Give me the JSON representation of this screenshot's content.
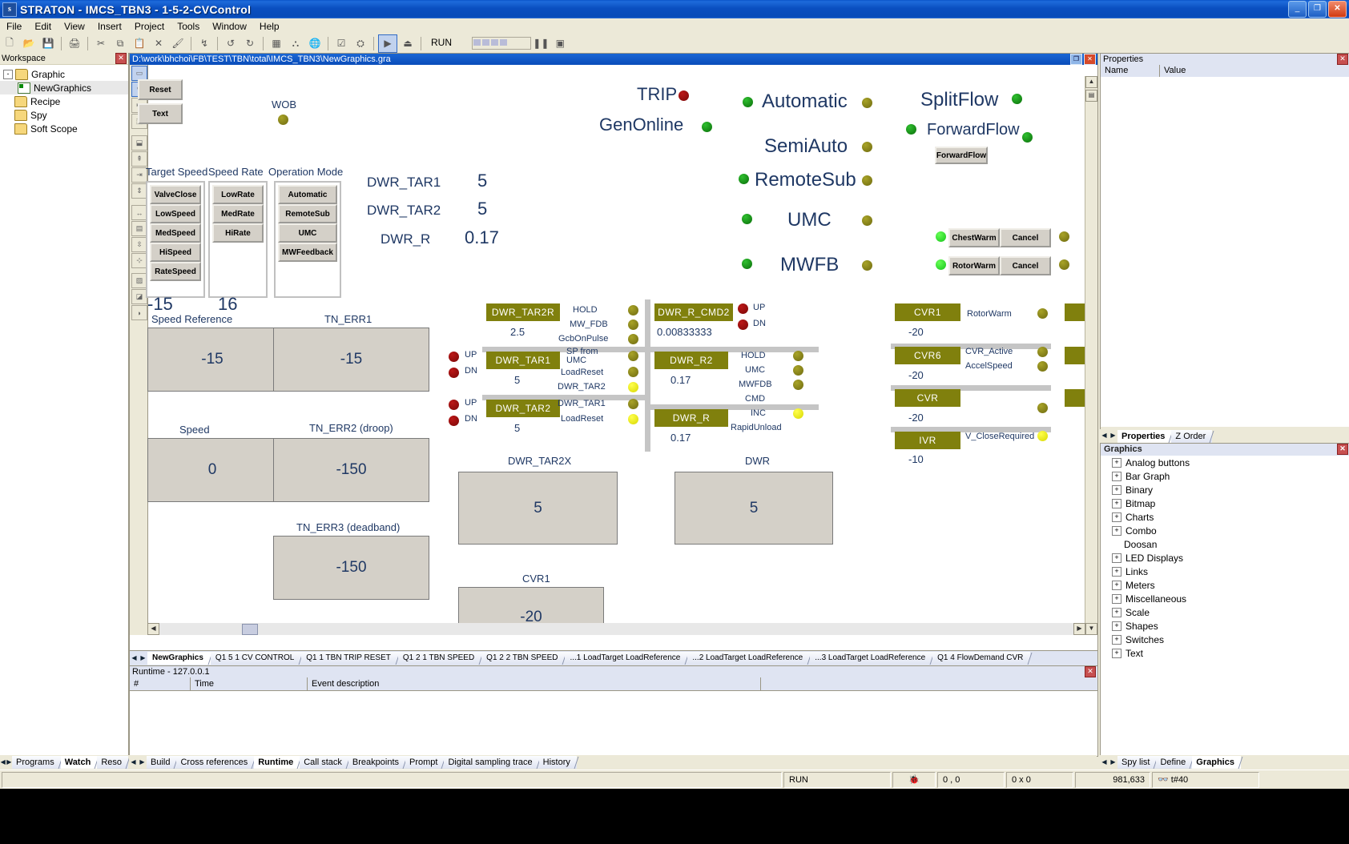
{
  "window": {
    "title": "STRATON - IMCS_TBN3 - 1-5-2-CVControl",
    "app_icon": "s",
    "minimize": "_",
    "maximize": "❐",
    "close": "✕"
  },
  "menu": [
    "File",
    "Edit",
    "View",
    "Insert",
    "Project",
    "Tools",
    "Window",
    "Help"
  ],
  "toolbar": {
    "icons": [
      "new-icon",
      "open-icon",
      "save-icon",
      "print-icon",
      "cut-icon",
      "copy-icon",
      "paste-icon",
      "delete-icon",
      "format-paint-icon",
      "undo-dropdown-icon",
      "undo-icon",
      "redo-icon",
      "grid-icon",
      "hierarchy-icon",
      "globe-icon",
      "check-icon",
      "compile-icon",
      "run-debug-icon",
      "stop-icon"
    ],
    "run_label": "RUN",
    "pause_icon": "❚❚",
    "stop_icon": "■"
  },
  "workspace": {
    "title": "Workspace",
    "close": "✕",
    "items": [
      {
        "label": "Graphic",
        "type": "folder",
        "toggle": "-",
        "selected": false
      },
      {
        "label": "NewGraphics",
        "type": "graphic",
        "toggle": "",
        "selected": true
      },
      {
        "label": "Recipe",
        "type": "folder",
        "toggle": "",
        "selected": false
      },
      {
        "label": "Spy",
        "type": "folder",
        "toggle": "",
        "selected": false
      },
      {
        "label": "Soft Scope",
        "type": "folder",
        "toggle": "",
        "selected": false
      }
    ],
    "tabs": [
      {
        "label": "Programs",
        "active": false
      },
      {
        "label": "Watch",
        "active": true
      },
      {
        "label": "Reso",
        "active": false
      }
    ]
  },
  "document": {
    "path": "D:\\work\\bhchoi\\FB\\TEST\\TBN\\total\\IMCS_TBN3\\NewGraphics.gra",
    "restore": "❐",
    "close": "✕"
  },
  "palette": {
    "buttons": [
      "select-rect-icon",
      "pointer-icon",
      "align-left-icon",
      "group-icon",
      "align-icons-icon",
      "align-top-icon",
      "align-right-icon",
      "center-vertical-icon",
      "distribute-h-icon",
      "distribute-v-icon",
      "spacing-icon",
      "pattern-icon",
      "pattern2-icon",
      "fill-icon"
    ]
  },
  "canvas": {
    "tool_buttons": [
      {
        "label": "Reset",
        "icon": "rect-tool-icon"
      },
      {
        "label": "Text",
        "icon": "text-tool-icon"
      }
    ],
    "wob": {
      "label": "WOB",
      "led": "olive"
    },
    "group_headers": [
      "Target Speed",
      "Speed Rate",
      "Operation Mode"
    ],
    "speed_buttons": [
      "ValveClose",
      "LowSpeed",
      "MedSpeed",
      "HiSpeed",
      "RateSpeed"
    ],
    "rate_buttons": [
      "LowRate",
      "MedRate",
      "HiRate"
    ],
    "mode_buttons": [
      "Automatic",
      "RemoteSub",
      "UMC",
      "MWFeedback"
    ],
    "group_values": [
      "-15",
      "16"
    ],
    "var_rows": [
      {
        "name": "DWR_TAR1",
        "value": "5"
      },
      {
        "name": "DWR_TAR2",
        "value": "5"
      },
      {
        "name": "DWR_R",
        "value": "0.17"
      }
    ],
    "status_left": [
      {
        "label": "TRIP",
        "led": "red",
        "side": "right"
      },
      {
        "label": "GenOnline",
        "led": "green",
        "side": "right"
      }
    ],
    "modes": [
      {
        "label": "Automatic",
        "led_left": "green",
        "led_right": "olive"
      },
      {
        "label": "SemiAuto",
        "led_left": "",
        "led_right": "olive"
      },
      {
        "label": "RemoteSub",
        "led_left": "green",
        "led_right": "olive"
      },
      {
        "label": "UMC",
        "led_left": "green",
        "led_right": "olive"
      },
      {
        "label": "MWFB",
        "led_left": "green",
        "led_right": "olive"
      }
    ],
    "flow": [
      {
        "label": "SplitFlow",
        "led": "green"
      },
      {
        "label": "ForwardFlow",
        "led": "green",
        "button": "ForwardFlow"
      }
    ],
    "warm_rows": [
      {
        "led": "bright-green",
        "button": "ChestWarm",
        "cancel": "Cancel",
        "led_right": "olive"
      },
      {
        "led": "bright-green",
        "button": "RotorWarm",
        "cancel": "Cancel",
        "led_right": "olive"
      }
    ],
    "meters": [
      {
        "title": "Speed Reference",
        "value": "-15"
      },
      {
        "title": "TN_ERR1",
        "value": "-15"
      },
      {
        "title": "Speed",
        "value": "0"
      },
      {
        "title": "TN_ERR2 (droop)",
        "value": "-150"
      },
      {
        "title": "TN_ERR3 (deadband)",
        "value": "-150"
      },
      {
        "title": "DWR_TAR2X",
        "value": "5"
      },
      {
        "title": "DWR",
        "value": "5"
      },
      {
        "title": "CVR1",
        "value": "-20"
      }
    ],
    "blocks": [
      {
        "tag": "DWR_TAR2R",
        "value": "2.5",
        "signals": [
          {
            "label": "HOLD",
            "led": "olive"
          },
          {
            "label": "MW_FDB",
            "led": "olive"
          },
          {
            "label": "GcbOnPulse",
            "led": "olive"
          }
        ],
        "updn": []
      },
      {
        "tag": "DWR_TAR1",
        "value": "5",
        "signals": [
          {
            "label": "SP from UMC",
            "led": "olive"
          },
          {
            "label": "LoadReset",
            "led": "olive"
          },
          {
            "label": "DWR_TAR2",
            "led": "yellow"
          }
        ],
        "updn": [
          {
            "label": "UP",
            "led": "red"
          },
          {
            "label": "DN",
            "led": "red"
          }
        ]
      },
      {
        "tag": "DWR_TAR2",
        "value": "5",
        "signals": [
          {
            "label": "DWR_TAR1",
            "led": "olive"
          },
          {
            "label": "LoadReset",
            "led": "yellow"
          }
        ],
        "updn": [
          {
            "label": "UP",
            "led": "red"
          },
          {
            "label": "DN",
            "led": "red"
          }
        ]
      },
      {
        "tag": "DWR_R_CMD2",
        "value": "0.00833333",
        "signals": [],
        "updn": [
          {
            "label": "UP",
            "led": "red"
          },
          {
            "label": "DN",
            "led": "red"
          }
        ]
      },
      {
        "tag": "DWR_R2",
        "value": "0.17",
        "signals": [
          {
            "label": "HOLD",
            "led": "olive"
          },
          {
            "label": "UMC",
            "led": "olive"
          },
          {
            "label": "MWFDB",
            "led": "olive"
          },
          {
            "label": "CMD",
            "led": "olive"
          }
        ],
        "updn": []
      },
      {
        "tag": "DWR_R",
        "value": "0.17",
        "signals": [
          {
            "label": "INC",
            "led": "yellow"
          },
          {
            "label": "RapidUnload",
            "led": "olive"
          }
        ],
        "updn": []
      }
    ],
    "cvr_blocks": [
      {
        "tag": "CVR1",
        "value": "-20",
        "signals": [
          "RotorWarm"
        ]
      },
      {
        "tag": "CVR6",
        "value": "-20",
        "signals": [
          "CVR_Active",
          "AccelSpeed"
        ]
      },
      {
        "tag": "CVR",
        "value": "-20",
        "signals": []
      },
      {
        "tag": "IVR",
        "value": "-10",
        "signals": [
          "V_CloseRequired"
        ]
      }
    ]
  },
  "doc_tabs": [
    {
      "label": "NewGraphics",
      "active": true
    },
    {
      "label": "Q1 5 1 CV CONTROL",
      "active": false
    },
    {
      "label": "Q1 1 TBN TRIP RESET",
      "active": false
    },
    {
      "label": "Q1 2 1 TBN SPEED",
      "active": false
    },
    {
      "label": "Q1 2 2 TBN SPEED",
      "active": false
    },
    {
      "label": "...1 LoadTarget LoadReference",
      "active": false
    },
    {
      "label": "...2 LoadTarget LoadReference",
      "active": false
    },
    {
      "label": "...3 LoadTarget LoadReference",
      "active": false
    },
    {
      "label": "Q1 4 FlowDemand CVR",
      "active": false
    }
  ],
  "runtime": {
    "title": "Runtime - 127.0.0.1",
    "close": "✕",
    "columns": [
      "#",
      "Time",
      "Event description"
    ]
  },
  "bottom_tabs": [
    {
      "label": "Build",
      "active": false
    },
    {
      "label": "Cross references",
      "active": false
    },
    {
      "label": "Runtime",
      "active": true
    },
    {
      "label": "Call stack",
      "active": false
    },
    {
      "label": "Breakpoints",
      "active": false
    },
    {
      "label": "Prompt",
      "active": false
    },
    {
      "label": "Digital sampling trace",
      "active": false
    },
    {
      "label": "History",
      "active": false
    }
  ],
  "properties": {
    "title": "Properties",
    "close": "✕",
    "columns": [
      "Name",
      "Value"
    ],
    "tabs": [
      {
        "label": "Properties",
        "active": true
      },
      {
        "label": "Z Order",
        "active": false
      }
    ]
  },
  "graphics_panel": {
    "title": "Graphics",
    "close": "✕",
    "items": [
      {
        "label": "Analog buttons",
        "expandable": true
      },
      {
        "label": "Bar Graph",
        "expandable": true
      },
      {
        "label": "Binary",
        "expandable": true
      },
      {
        "label": "Bitmap",
        "expandable": true
      },
      {
        "label": "Charts",
        "expandable": true
      },
      {
        "label": "Combo",
        "expandable": true
      },
      {
        "label": "Doosan",
        "expandable": false
      },
      {
        "label": "LED Displays",
        "expandable": true
      },
      {
        "label": "Links",
        "expandable": true
      },
      {
        "label": "Meters",
        "expandable": true
      },
      {
        "label": "Miscellaneous",
        "expandable": true
      },
      {
        "label": "Scale",
        "expandable": true
      },
      {
        "label": "Shapes",
        "expandable": true
      },
      {
        "label": "Switches",
        "expandable": true
      },
      {
        "label": "Text",
        "expandable": true
      }
    ],
    "tabs": [
      {
        "label": "Spy list",
        "active": false
      },
      {
        "label": "Define",
        "active": false
      },
      {
        "label": "Graphics",
        "active": true
      }
    ]
  },
  "status_bar": {
    "run": "RUN",
    "cursor": "0 , 0",
    "size": "0 x 0",
    "memory": "981,633",
    "cycle": "t#40",
    "bug_icon": "bug-icon",
    "binocular_icon": "binoculars-icon"
  },
  "colors": {
    "title_blue": "#0a4fc0",
    "olive_tag": "#80800d",
    "dark_text": "#1f3864",
    "panel": "#ece9d8",
    "tab_blue": "#dfe4f2"
  }
}
